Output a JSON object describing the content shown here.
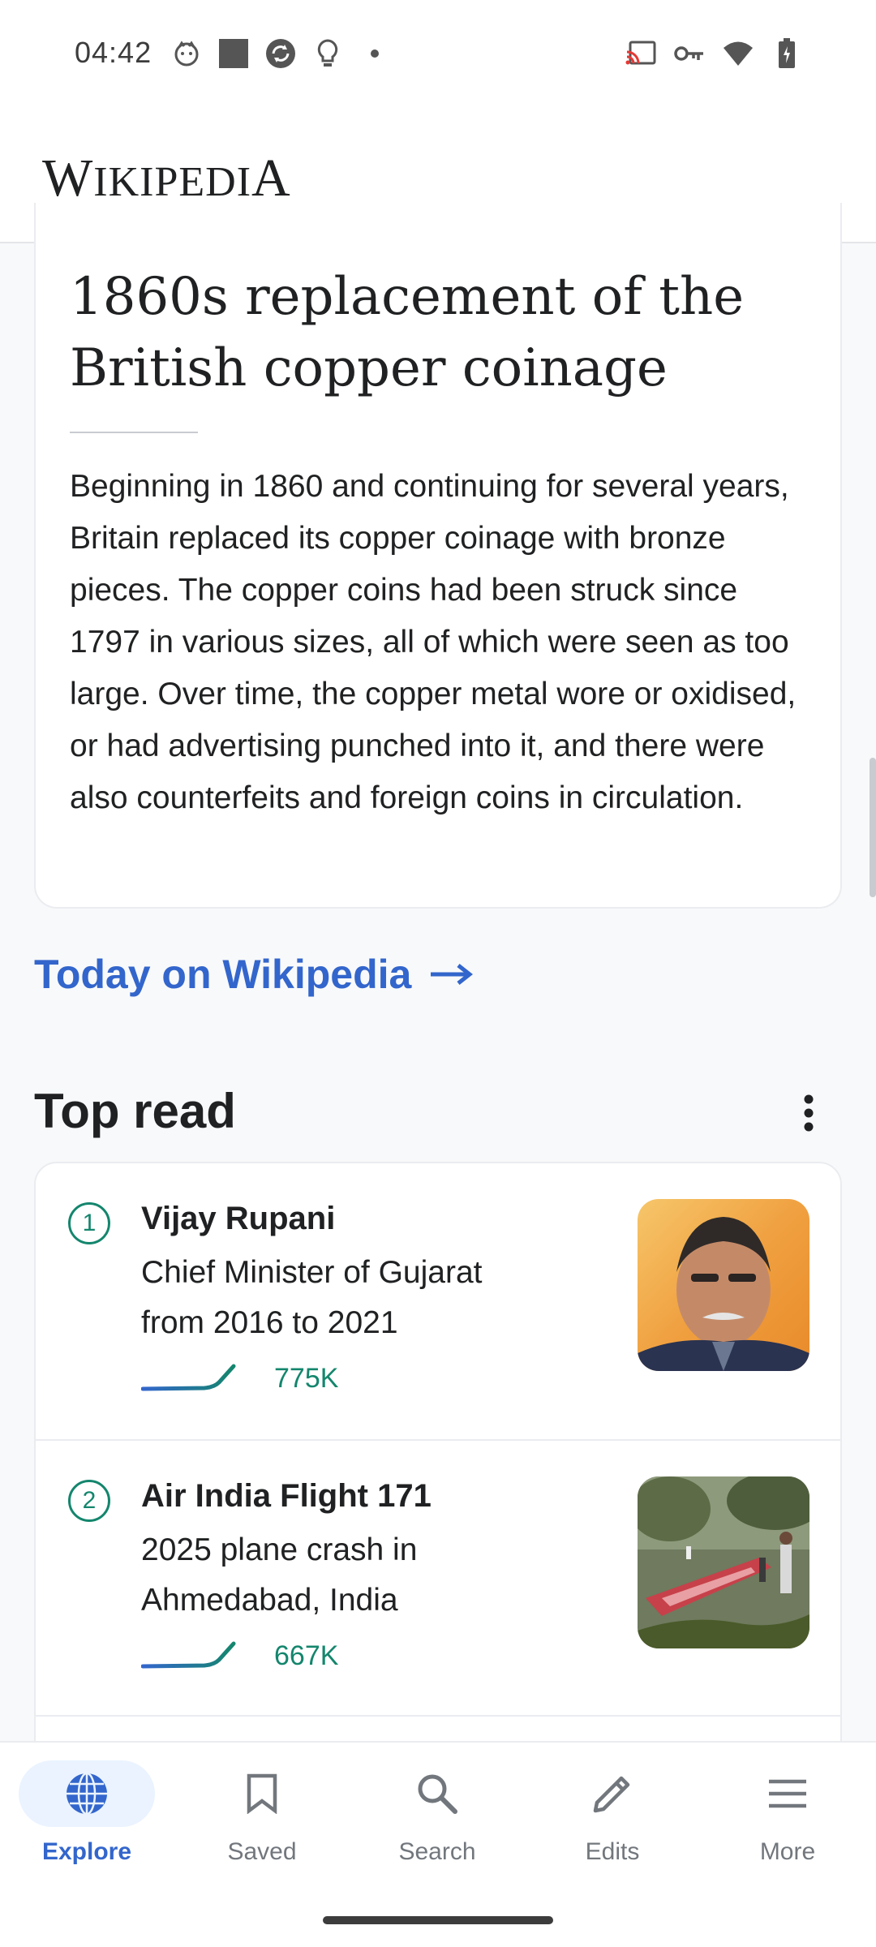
{
  "status_bar": {
    "time": "04:42",
    "left_icons": [
      "cat-face-icon",
      "square-icon",
      "sync-icon",
      "lightbulb-icon",
      "dot-icon"
    ],
    "right_icons": [
      "cast-icon",
      "vpn-key-icon",
      "wifi-icon",
      "battery-icon"
    ]
  },
  "app_bar": {
    "wordmark_W": "W",
    "wordmark_mid": "IKIPEDI",
    "wordmark_A": "A"
  },
  "featured": {
    "title": "1860s replacement of the British copper coinage",
    "extract": "Beginning in 1860 and continuing for several years, Britain replaced its copper coinage with bronze pieces. The copper coins had been struck since 1797 in various sizes, all of which were seen as too large. Over time, the copper metal wore or oxidised, or had advertising punched into it, and there were also counterfeits and foreign coins in circulation."
  },
  "today_link": {
    "label": "Today on Wikipedia",
    "arrow": "→"
  },
  "top_read": {
    "title": "Top read",
    "items": [
      {
        "rank": "1",
        "title": "Vijay Rupani",
        "description": "Chief Minister of Gujarat from 2016 to 2021",
        "views": "775K"
      },
      {
        "rank": "2",
        "title": "Air India Flight 171",
        "description": "2025 plane crash in Ahmedabad, India",
        "views": "667K"
      }
    ]
  },
  "bottom_nav": {
    "items": [
      {
        "label": "Explore",
        "icon": "globe-icon",
        "active": true
      },
      {
        "label": "Saved",
        "icon": "bookmark-icon",
        "active": false
      },
      {
        "label": "Search",
        "icon": "search-icon",
        "active": false
      },
      {
        "label": "Edits",
        "icon": "pencil-icon",
        "active": false
      },
      {
        "label": "More",
        "icon": "menu-icon",
        "active": false
      }
    ]
  },
  "colors": {
    "accent": "#3366cc",
    "trend": "#14866d",
    "text": "#202122"
  }
}
